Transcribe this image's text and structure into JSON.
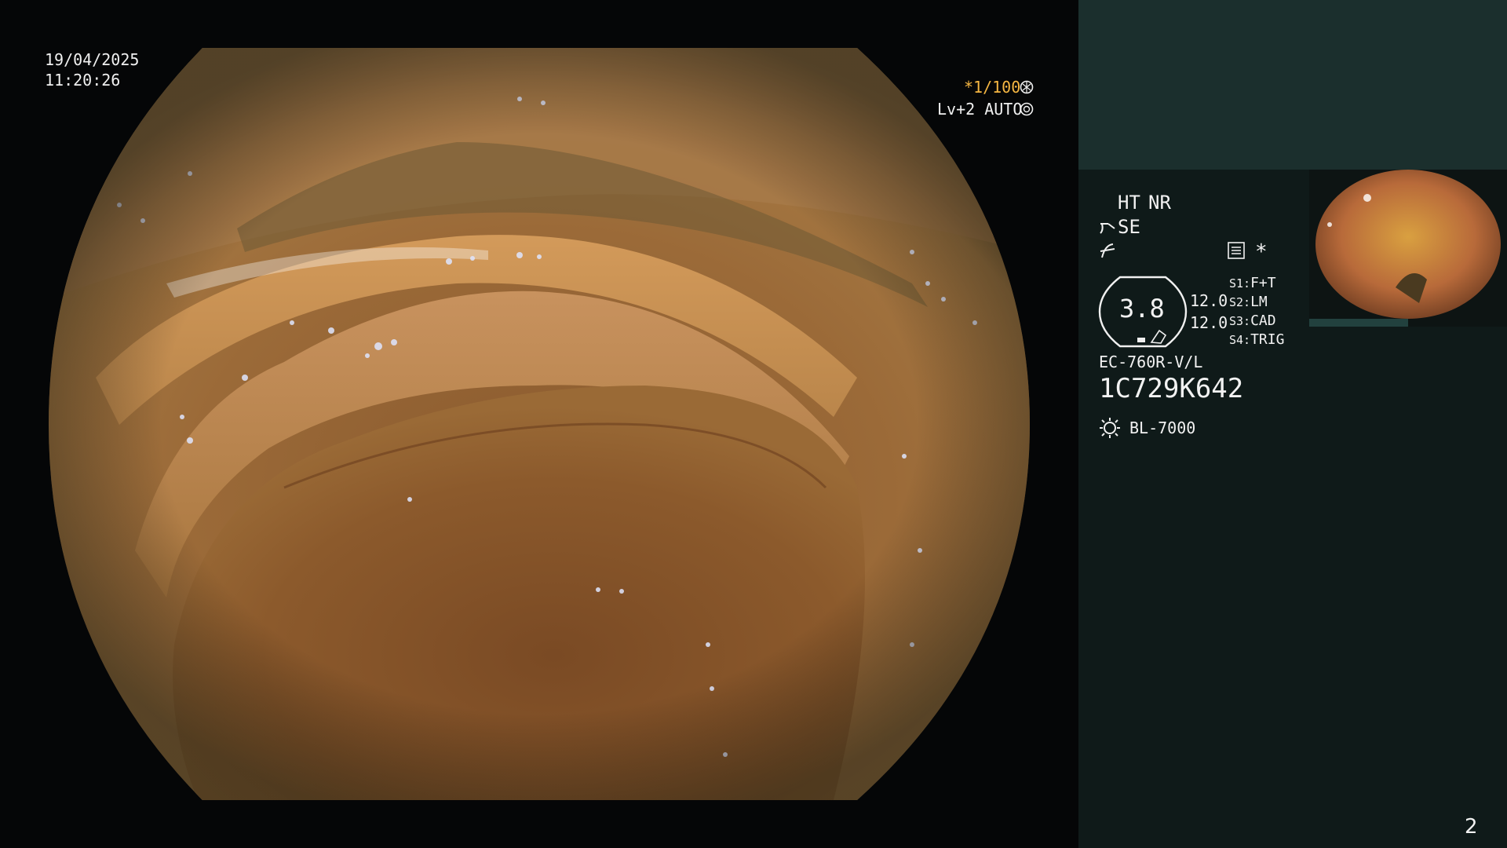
{
  "overlay": {
    "date": "19/04/2025",
    "time": "11:20:26",
    "shutter": "*1/100",
    "shutter_icon": "aperture-icon",
    "level_mode": "Lv+2 AUTO",
    "level_icon": "iris-icon"
  },
  "panel": {
    "ht_label": "HT",
    "nr_label": "NR",
    "se_label": "SE",
    "se_icon": "scope-tip-icon",
    "f_icon": "f-curve-icon",
    "menu_icon": "settings-list-icon",
    "asterisk": "*",
    "zoom_value": "3.8",
    "gauge_top": "12.0",
    "gauge_bottom": "12.0",
    "switches": [
      {
        "key": "S1:",
        "value": "F+T"
      },
      {
        "key": "S2:",
        "value": "LM"
      },
      {
        "key": "S3:",
        "value": "CAD"
      },
      {
        "key": "S4:",
        "value": "TRIG"
      }
    ],
    "scope_model": "EC-760R-V/L",
    "serial": "1C729K642",
    "light_icon": "light-source-icon",
    "light_source": "BL-7000"
  },
  "page_number": "2",
  "colors": {
    "panel_top": "#1b2f2d",
    "panel": "#0f1a19",
    "accent_amber": "#f5b642",
    "tissue_base": "#9a6a36"
  }
}
